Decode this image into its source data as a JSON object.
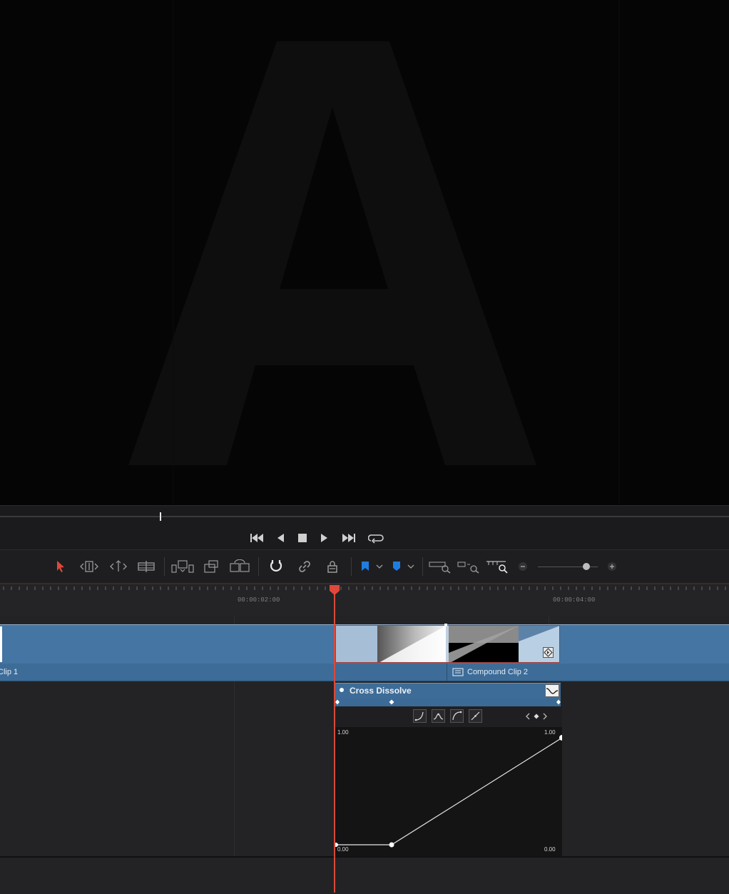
{
  "viewer": {
    "overlay_letter": "A"
  },
  "ruler": {
    "timecode_1": "00:00:02:00",
    "timecode_2": "00:00:04:00"
  },
  "timeline": {
    "clip_left_label": "Clip 1",
    "clip_right_label": "Compound Clip 2"
  },
  "transition": {
    "title": "Cross Dissolve",
    "graph": {
      "top_left_label": "1.00",
      "top_right_label": "1.00",
      "bottom_left_label": "0.00",
      "bottom_right_label": "0.00"
    }
  },
  "colors": {
    "accent_red": "#d9493b",
    "clip_blue": "#4475a3",
    "marker_blue": "#1f7de0"
  }
}
